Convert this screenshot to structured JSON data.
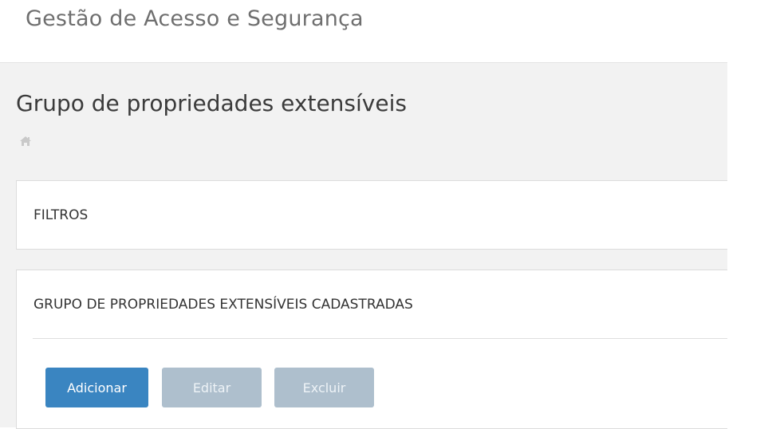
{
  "header": {
    "app_title": "Gestão de Acesso e Segurança"
  },
  "page": {
    "title": "Grupo de propriedades extensíveis",
    "breadcrumb_icon": "home-icon"
  },
  "filters_panel": {
    "heading": "FILTROS"
  },
  "list_panel": {
    "heading": "GRUPO DE PROPRIEDADES EXTENSÍVEIS CADASTRADAS",
    "buttons": {
      "add": "Adicionar",
      "edit": "Editar",
      "delete": "Excluir"
    }
  },
  "colors": {
    "primary": "#3a85c1",
    "disabled": "#aebfcd",
    "content_bg": "#f2f2f2"
  }
}
